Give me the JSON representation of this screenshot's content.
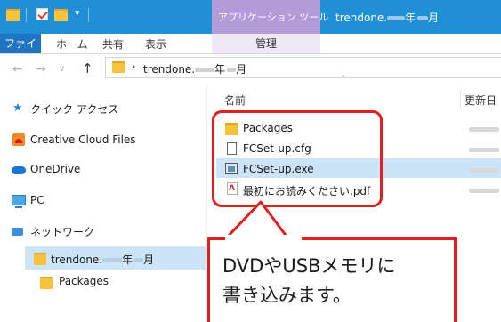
{
  "window": {
    "title_prefix": "trendone.",
    "title_year": "年",
    "title_month": "月"
  },
  "ribbon": {
    "context_tab_group": "アプリケーション ツール",
    "tabs": [
      "ファイル",
      "ホーム",
      "共有",
      "表示",
      "管理"
    ]
  },
  "address": {
    "path_prefix": "trendone.",
    "path_year": "年",
    "path_month": "月"
  },
  "nav_pane": {
    "items": [
      {
        "label": "クイック アクセス",
        "icon": "star-icon"
      },
      {
        "label": "Creative Cloud Files",
        "icon": "creative-cloud-icon"
      },
      {
        "label": "OneDrive",
        "icon": "cloud-icon"
      },
      {
        "label": "PC",
        "icon": "computer-icon"
      },
      {
        "label": "ネットワーク",
        "icon": "network-icon"
      }
    ],
    "selected_folder": {
      "prefix": "trendone.",
      "year": "年",
      "month": "月"
    },
    "subfolder": "Packages"
  },
  "file_list": {
    "columns": [
      "名前",
      "更新日"
    ],
    "files": [
      {
        "name": "Packages",
        "icon": "folder-icon"
      },
      {
        "name": "FCSet-up.cfg",
        "icon": "document-icon"
      },
      {
        "name": "FCSet-up.exe",
        "icon": "application-icon",
        "selected": true
      },
      {
        "name": "最初にお読みください.pdf",
        "icon": "pdf-icon"
      }
    ]
  },
  "callout": {
    "text": "DVDやUSBメモリに\n書き込みます。",
    "color": "#e02020"
  },
  "colors": {
    "titlebar": "#1f8fd6",
    "context_tab": "#b39ad8",
    "selection": "#cce4f7"
  }
}
